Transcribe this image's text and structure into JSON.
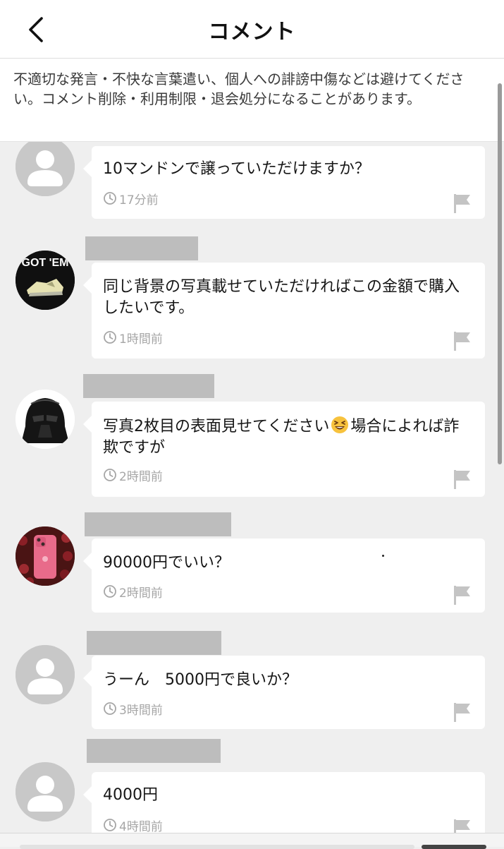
{
  "header": {
    "title": "コメント",
    "back_icon": "chevron-left-icon"
  },
  "notice": {
    "text": "不適切な発言・不快な言葉遣い、個人への誹謗中傷などは避けてください。コメント削除・利用制限・退会処分になることがあります。"
  },
  "comments": [
    {
      "avatar": "default-user-icon",
      "text": "10マンドンで譲っていただけますか？",
      "time": "17分前"
    },
    {
      "avatar": "gotem-sneaker-photo",
      "avatar_text": "GOT 'EM",
      "text": "同じ背景の写真載せていただければこの金額で購入したいです。",
      "time": "1時間前"
    },
    {
      "avatar": "darth-vader-helmet-photo",
      "text_before": "写真2枚目の表面見せてください",
      "emoji": "grinning-squinting-face-emoji",
      "text_after": "場合によれば詐欺ですが",
      "time": "2時間前"
    },
    {
      "avatar": "pink-phone-photo",
      "text": "90000円でいい？",
      "time": "2時間前"
    },
    {
      "avatar": "default-user-icon",
      "text": "うーん　5000円で良いか？",
      "time": "3時間前"
    },
    {
      "avatar": "default-user-icon",
      "text": "4000円",
      "time": "4時間前"
    }
  ],
  "icons": {
    "timestamp": "clock-icon",
    "report": "flag-icon"
  },
  "colors": {
    "background": "#efefef",
    "bubble": "#ffffff",
    "muted_text": "#a6a6a6",
    "redaction": "#bdbdbd"
  }
}
